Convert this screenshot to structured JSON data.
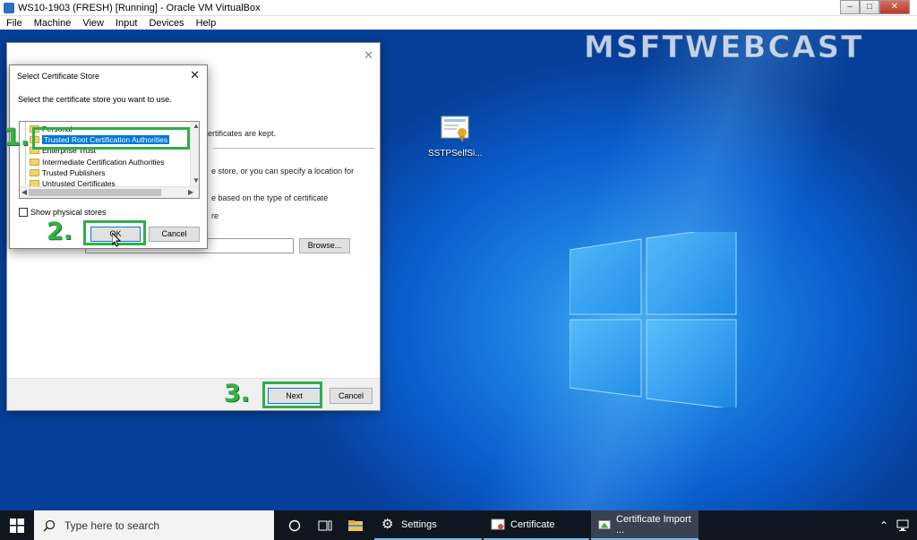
{
  "host": {
    "title": "WS10-1903 (FRESH) [Running] - Oracle VM VirtualBox",
    "menu": [
      "File",
      "Machine",
      "View",
      "Input",
      "Devices",
      "Help"
    ]
  },
  "watermark": "MSFTWEBCAST",
  "desktop_icon": {
    "label": "SSTPSelfSi..."
  },
  "wizard": {
    "line1": "ertificates are kept.",
    "line2": "e store, or you can specify a location for",
    "line3": "e based on the type of certificate",
    "line4": "re",
    "browse_label": "Browse...",
    "next_label": "Next",
    "cancel_label": "Cancel"
  },
  "store_dialog": {
    "title": "Select Certificate Store",
    "prompt": "Select the certificate store you want to use.",
    "items": [
      "Personal",
      "Trusted Root Certification Authorities",
      "Enterprise Trust",
      "Intermediate Certification Authorities",
      "Trusted Publishers",
      "Untrusted Certificates"
    ],
    "selected_index": 1,
    "show_physical_label": "Show physical stores",
    "show_physical_checked": false,
    "ok_label": "OK",
    "cancel_label": "Cancel"
  },
  "steps": [
    "1.",
    "2.",
    "3."
  ],
  "taskbar": {
    "search_placeholder": "Type here to search",
    "apps": [
      {
        "label": "Settings",
        "icon": "gear-icon"
      },
      {
        "label": "Certificate",
        "icon": "certificate-icon"
      },
      {
        "label": "Certificate Import ...",
        "icon": "certificate-wizard-icon"
      }
    ]
  }
}
